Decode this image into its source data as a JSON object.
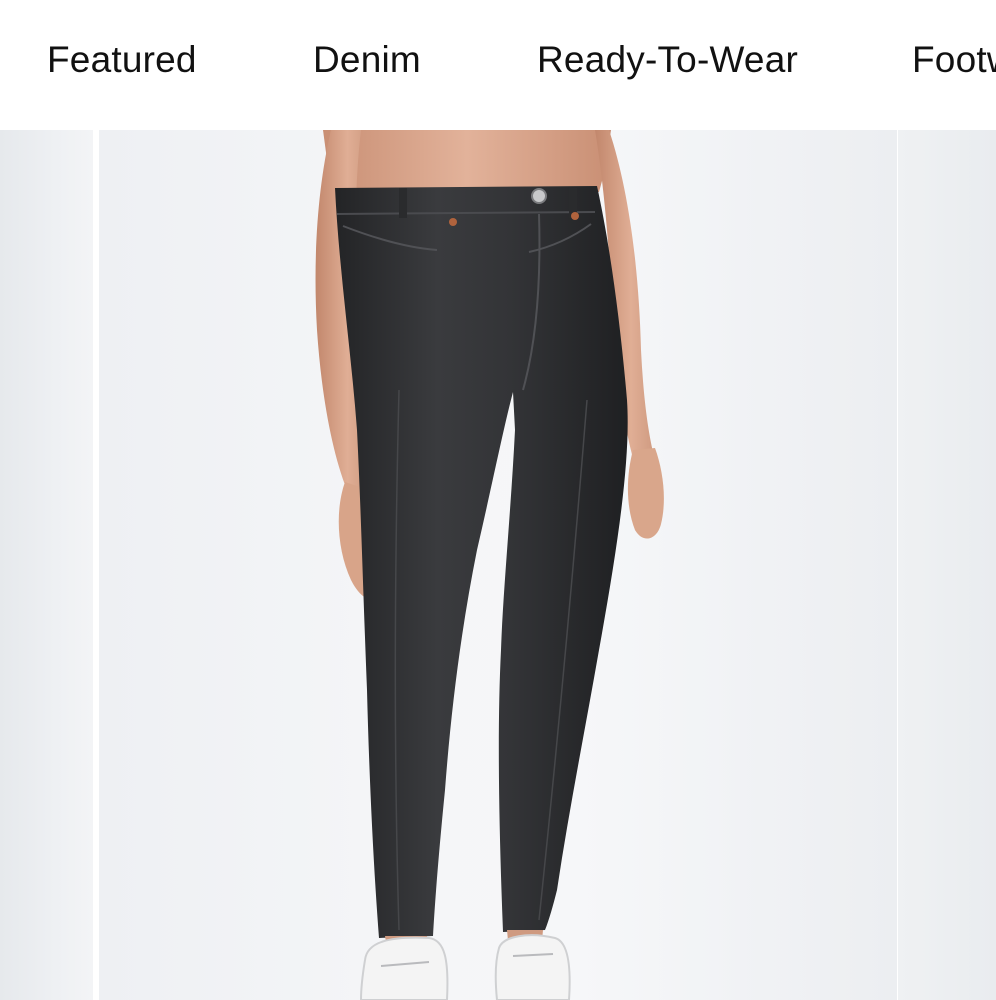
{
  "nav": {
    "tabs": [
      {
        "label": "Featured"
      },
      {
        "label": "Denim"
      },
      {
        "label": "Ready-To-Wear"
      },
      {
        "label": "Footw"
      }
    ]
  },
  "carousel": {
    "main_image": {
      "icon": "product-photo-high-rise-black-jeans",
      "colors": {
        "denim": "#2f3032",
        "skin": "#d9a58b",
        "background": "#f4f5f7"
      }
    }
  }
}
